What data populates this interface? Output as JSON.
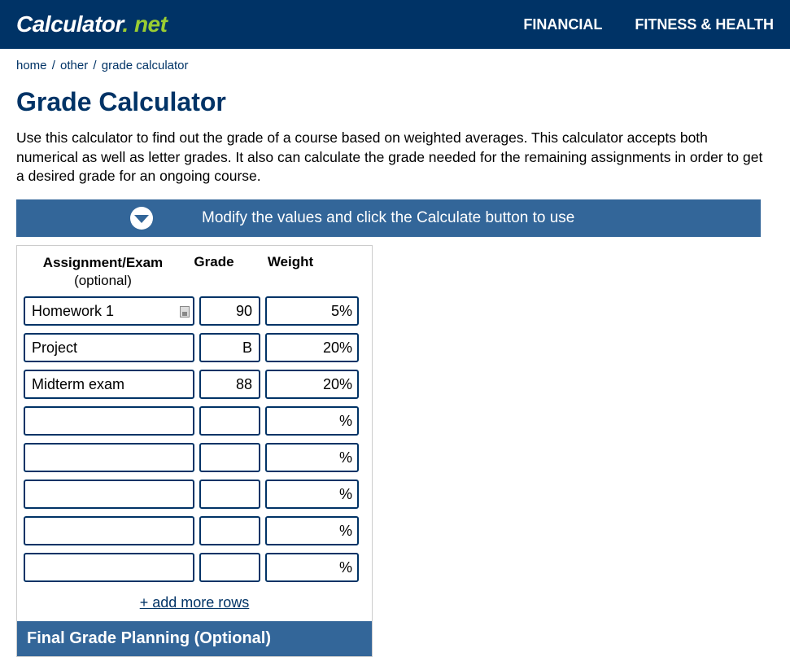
{
  "logo": {
    "prefix": "Calculator",
    "dot": ".",
    "suffix": " net"
  },
  "nav": {
    "financial": "FINANCIAL",
    "fitness": "FITNESS & HEALTH"
  },
  "breadcrumb": {
    "home": "home",
    "other": "other",
    "current": "grade calculator",
    "sep": "/"
  },
  "title": "Grade Calculator",
  "intro": "Use this calculator to find out the grade of a course based on weighted averages. This calculator accepts both numerical as well as letter grades. It also can calculate the grade needed for the remaining assignments in order to get a desired grade for an ongoing course.",
  "instruction": "Modify the values and click the Calculate button to use",
  "headers": {
    "assignment": "Assignment/Exam",
    "optional": "(optional)",
    "grade": "Grade",
    "weight": "Weight"
  },
  "rows": [
    {
      "assignment": "Homework 1",
      "grade": "90",
      "weight": "5"
    },
    {
      "assignment": "Project",
      "grade": "B",
      "weight": "20"
    },
    {
      "assignment": "Midterm exam",
      "grade": "88",
      "weight": "20"
    },
    {
      "assignment": "",
      "grade": "",
      "weight": ""
    },
    {
      "assignment": "",
      "grade": "",
      "weight": ""
    },
    {
      "assignment": "",
      "grade": "",
      "weight": ""
    },
    {
      "assignment": "",
      "grade": "",
      "weight": ""
    },
    {
      "assignment": "",
      "grade": "",
      "weight": ""
    }
  ],
  "pct_symbol": "%",
  "add_more": "+ add more rows",
  "planning_title": "Final Grade Planning (Optional)"
}
